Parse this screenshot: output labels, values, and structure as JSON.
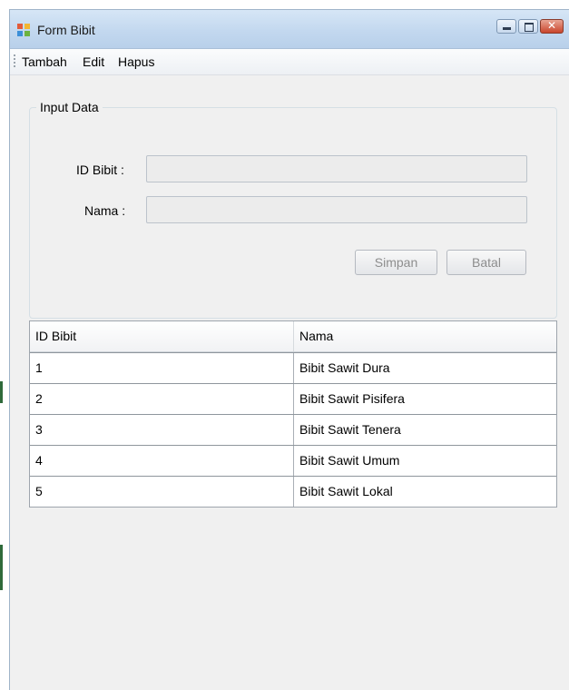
{
  "window": {
    "title": "Form Bibit"
  },
  "menu": {
    "items": [
      "Tambah",
      "Edit",
      "Hapus"
    ]
  },
  "input_group": {
    "title": "Input Data",
    "id_label": "ID Bibit :",
    "id_value": "",
    "name_label": "Nama :",
    "name_value": "",
    "save_label": "Simpan",
    "cancel_label": "Batal"
  },
  "table": {
    "columns": [
      "ID Bibit",
      "Nama"
    ],
    "rows": [
      [
        "1",
        "Bibit Sawit Dura"
      ],
      [
        "2",
        "Bibit Sawit Pisifera"
      ],
      [
        "3",
        "Bibit Sawit Tenera"
      ],
      [
        "4",
        "Bibit Sawit Umum"
      ],
      [
        "5",
        "Bibit Sawit Lokal"
      ]
    ]
  },
  "icons": {
    "app": "form-app-icon",
    "minimize": "minimize-icon",
    "maximize": "maximize-icon",
    "close": "close-icon"
  }
}
